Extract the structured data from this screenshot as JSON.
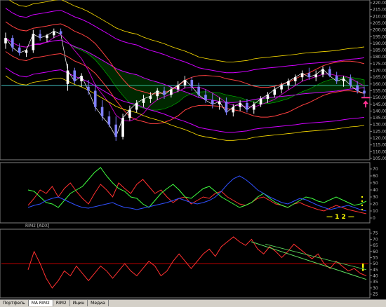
{
  "app": {
    "tabs": [
      {
        "label": "Портфель",
        "active": false
      },
      {
        "label": "МА RIM2",
        "active": true
      },
      {
        "label": "RIM2",
        "active": false
      },
      {
        "label": "Ицин",
        "active": false
      },
      {
        "label": "Медиа",
        "active": false
      }
    ]
  },
  "panels": {
    "adx_label": "RIM2 [ADX]"
  },
  "annotations": {
    "marks": "— 1 2 —",
    "exclamation": "!"
  },
  "colors": {
    "background": "#000000",
    "candle_up": "#ffffff",
    "candle_down": "#8080ff",
    "ma_red": "#ff4040",
    "ma_magenta": "#c000c0",
    "bollinger": "#d000ff",
    "envelope_yellow": "#ffe000",
    "cloud_green": "#00c000",
    "baseline_teal": "#40c0c0",
    "adx_green": "#40ff40",
    "adx_red": "#ff3030",
    "adx_blue": "#3050ff",
    "annotation_yellow": "#ffff00",
    "arrow_pink": "#ff3090"
  },
  "chart_data": [
    {
      "type": "candlestick",
      "title": "",
      "ylim": [
        105000,
        220000
      ],
      "yticks": [
        105000,
        110000,
        115000,
        120000,
        125000,
        130000,
        135000,
        140000,
        145000,
        150000,
        155000,
        160000,
        165000,
        170000,
        175000,
        180000,
        185000,
        190000,
        195000,
        200000,
        205000,
        210000,
        215000,
        220000
      ],
      "ytick_labels": [
        "105.000",
        "110.000",
        "115.000",
        "120.000",
        "125.000",
        "130.000",
        "135.000",
        "140.000",
        "145.000",
        "150.000",
        "155.000",
        "160.000",
        "165.000",
        "170.000",
        "175.000",
        "180.000",
        "185.000",
        "190.000",
        "195.000",
        "200.000",
        "205.000",
        "210.000",
        "215.000",
        "220.000"
      ],
      "horizontal_line": 159000,
      "arrow_at": 152000,
      "candles": [
        [
          190000,
          198000,
          186000,
          194000
        ],
        [
          194000,
          196000,
          184000,
          187000
        ],
        [
          187000,
          190000,
          181000,
          183000
        ],
        [
          183000,
          186000,
          180000,
          185000
        ],
        [
          185000,
          200000,
          183000,
          197000
        ],
        [
          197000,
          200000,
          192000,
          194000
        ],
        [
          194000,
          197000,
          191000,
          196000
        ],
        [
          196000,
          201000,
          194000,
          199000
        ],
        [
          199000,
          201000,
          196000,
          197000
        ],
        [
          160000,
          175000,
          155000,
          170000
        ],
        [
          170000,
          172000,
          160000,
          162000
        ],
        [
          162000,
          168000,
          158000,
          166000
        ],
        [
          158000,
          163000,
          152000,
          155000
        ],
        [
          155000,
          160000,
          140000,
          143000
        ],
        [
          143000,
          148000,
          133000,
          136000
        ],
        [
          136000,
          140000,
          128000,
          130000
        ],
        [
          130000,
          136000,
          118000,
          121000
        ],
        [
          121000,
          138000,
          119000,
          135000
        ],
        [
          135000,
          144000,
          133000,
          141000
        ],
        [
          141000,
          148000,
          139000,
          146000
        ],
        [
          146000,
          152000,
          143000,
          149000
        ],
        [
          149000,
          154000,
          146000,
          151000
        ],
        [
          151000,
          157000,
          148000,
          155000
        ],
        [
          155000,
          158000,
          149000,
          152000
        ],
        [
          152000,
          158000,
          150000,
          156000
        ],
        [
          156000,
          162000,
          154000,
          159000
        ],
        [
          159000,
          166000,
          157000,
          163000
        ],
        [
          163000,
          165000,
          155000,
          158000
        ],
        [
          158000,
          161000,
          150000,
          152000
        ],
        [
          152000,
          156000,
          146000,
          148000
        ],
        [
          148000,
          153000,
          142000,
          145000
        ],
        [
          145000,
          150000,
          141000,
          147000
        ],
        [
          147000,
          150000,
          137000,
          139000
        ],
        [
          139000,
          145000,
          136000,
          143000
        ],
        [
          143000,
          148000,
          140000,
          146000
        ],
        [
          146000,
          149000,
          139000,
          141000
        ],
        [
          141000,
          147000,
          138000,
          145000
        ],
        [
          145000,
          151000,
          143000,
          149000
        ],
        [
          149000,
          154000,
          146000,
          152000
        ],
        [
          152000,
          158000,
          150000,
          156000
        ],
        [
          156000,
          161000,
          153000,
          159000
        ],
        [
          159000,
          164000,
          156000,
          162000
        ],
        [
          162000,
          167000,
          159000,
          165000
        ],
        [
          165000,
          170000,
          162000,
          168000
        ],
        [
          168000,
          172000,
          163000,
          165000
        ],
        [
          165000,
          170000,
          162000,
          167000
        ],
        [
          167000,
          173000,
          165000,
          171000
        ],
        [
          171000,
          173000,
          165000,
          166000
        ],
        [
          166000,
          169000,
          160000,
          162000
        ],
        [
          162000,
          166000,
          158000,
          164000
        ],
        [
          164000,
          167000,
          157000,
          159000
        ],
        [
          159000,
          162000,
          153000,
          155000
        ],
        [
          155000,
          158000,
          150000,
          153000
        ]
      ]
    },
    {
      "type": "line",
      "title": "",
      "ylim": [
        -5,
        75
      ],
      "yticks": [
        0,
        10,
        20,
        30,
        40,
        50,
        60,
        70
      ],
      "ytick_labels": [
        "0",
        "10",
        "20",
        "30",
        "40",
        "50",
        "60",
        "70"
      ],
      "series": [
        {
          "color": "#ff3030",
          "values": [
            18,
            28,
            40,
            35,
            45,
            30,
            42,
            50,
            38,
            28,
            20,
            35,
            48,
            40,
            30,
            50,
            42,
            35,
            48,
            55,
            45,
            35,
            40,
            30,
            22,
            28,
            30,
            20,
            25,
            30,
            28,
            35,
            38,
            30,
            25,
            20,
            18,
            22,
            28,
            30,
            25,
            20,
            18,
            15,
            20,
            22,
            18,
            15,
            12,
            10,
            14,
            18,
            15,
            12,
            10,
            8,
            6
          ]
        },
        {
          "color": "#40ff40",
          "values": [
            40,
            38,
            30,
            22,
            20,
            15,
            25,
            35,
            40,
            45,
            55,
            65,
            72,
            60,
            50,
            42,
            38,
            30,
            28,
            20,
            15,
            25,
            35,
            42,
            48,
            40,
            30,
            28,
            35,
            42,
            45,
            38,
            30,
            25,
            20,
            15,
            18,
            22,
            30,
            35,
            28,
            22,
            18,
            15,
            20,
            25,
            30,
            28,
            24,
            22,
            26,
            30,
            26,
            22,
            18,
            20,
            24
          ]
        },
        {
          "color": "#3050ff",
          "values": [
            15,
            18,
            20,
            25,
            28,
            30,
            26,
            22,
            18,
            15,
            14,
            16,
            18,
            20,
            22,
            18,
            15,
            14,
            12,
            14,
            16,
            18,
            20,
            22,
            25,
            28,
            25,
            22,
            20,
            22,
            25,
            30,
            38,
            48,
            56,
            60,
            55,
            48,
            40,
            35,
            30,
            26,
            22,
            20,
            24,
            28,
            26,
            22,
            18,
            15,
            12,
            14,
            16,
            18,
            15,
            12,
            10
          ]
        }
      ],
      "annotation": "— 1 2 —"
    },
    {
      "type": "line",
      "title": "",
      "ylim": [
        23,
        76
      ],
      "yticks": [
        25,
        30,
        35,
        40,
        45,
        50,
        55,
        60,
        65,
        70,
        75
      ],
      "ytick_labels": [
        "25",
        "30",
        "35",
        "40",
        "45",
        "50",
        "55",
        "60",
        "65",
        "70",
        "75"
      ],
      "horizontal_line": 50,
      "series": [
        {
          "color": "#ff3030",
          "values": [
            45,
            60,
            50,
            38,
            30,
            36,
            44,
            40,
            48,
            42,
            36,
            42,
            48,
            44,
            38,
            44,
            50,
            44,
            40,
            46,
            52,
            48,
            40,
            44,
            52,
            58,
            52,
            46,
            52,
            58,
            62,
            56,
            64,
            68,
            72,
            68,
            65,
            70,
            62,
            58,
            64,
            60,
            55,
            60,
            66,
            62,
            58,
            54,
            58,
            50,
            46,
            52,
            48,
            44,
            46,
            42,
            40
          ]
        }
      ],
      "trendline": [
        [
          0.66,
          68
        ],
        [
          1.0,
          37
        ]
      ]
    }
  ]
}
